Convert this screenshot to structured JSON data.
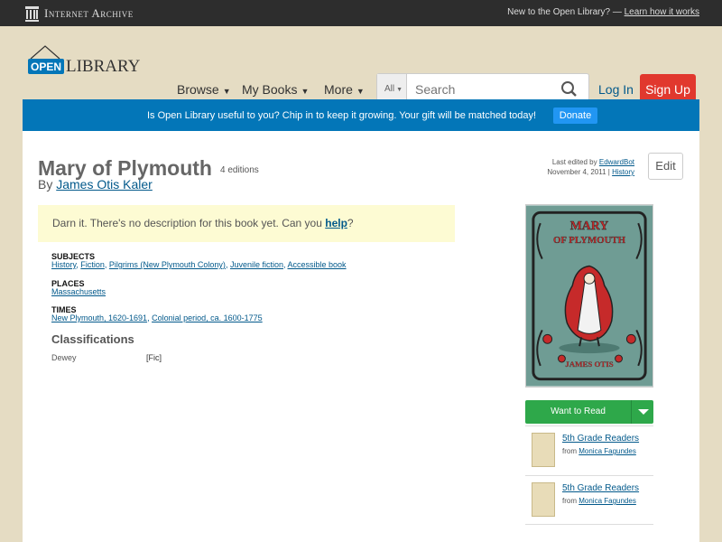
{
  "ia_bar": {
    "logo_text": "Internet Archive",
    "new_text": "New to the Open Library? —",
    "learn_link": "Learn how it works"
  },
  "header": {
    "logo_open": "OPEN",
    "logo_library": "LIBRARY",
    "nav": [
      {
        "label": "Browse"
      },
      {
        "label": "My Books"
      },
      {
        "label": "More"
      }
    ],
    "search_scope": "All",
    "search_placeholder": "Search",
    "login": "Log In",
    "signup": "Sign Up"
  },
  "donate": {
    "text": "Is Open Library useful to you? Chip in to keep it growing. Your gift will be matched today!",
    "button": "Donate"
  },
  "book": {
    "title": "Mary of Plymouth",
    "editions": "4 editions",
    "by": "By",
    "author": "James Otis Kaler",
    "last_edited_prefix": "Last edited by",
    "last_edited_by": "EdwardBot",
    "last_edited_date": "November 4, 2011",
    "history_link": "History",
    "edit_button": "Edit",
    "description_text": "Darn it. There's no description for this book yet. Can you",
    "description_help": "help",
    "description_end": "?",
    "subjects_label": "Subjects",
    "subjects": [
      "History",
      "Fiction",
      "Pilgrims (New Plymouth Colony)",
      "Juvenile fiction",
      "Accessible book"
    ],
    "places_label": "Places",
    "places": [
      "Massachusetts"
    ],
    "times_label": "Times",
    "times": [
      "New Plymouth, 1620-1691",
      "Colonial period, ca. 1600-1775"
    ],
    "classifications_label": "Classifications",
    "dewey_label": "Dewey",
    "dewey_value": "[Fic]",
    "cover_title_line1": "MARY",
    "cover_title_line2": "OF PLYMOUTH",
    "cover_author": "JAMES OTIS"
  },
  "sidebar": {
    "want_to_read": "Want to Read",
    "lists": [
      {
        "title": "5th Grade Readers",
        "from": "from",
        "owner": "Monica Fagundes"
      },
      {
        "title": "5th Grade Readers",
        "from": "from",
        "owner": "Monica Fagundes"
      }
    ]
  },
  "colors": {
    "signup_red": "#e1382e",
    "donate_blue": "#0376b8",
    "want_green": "#2ea84a"
  }
}
